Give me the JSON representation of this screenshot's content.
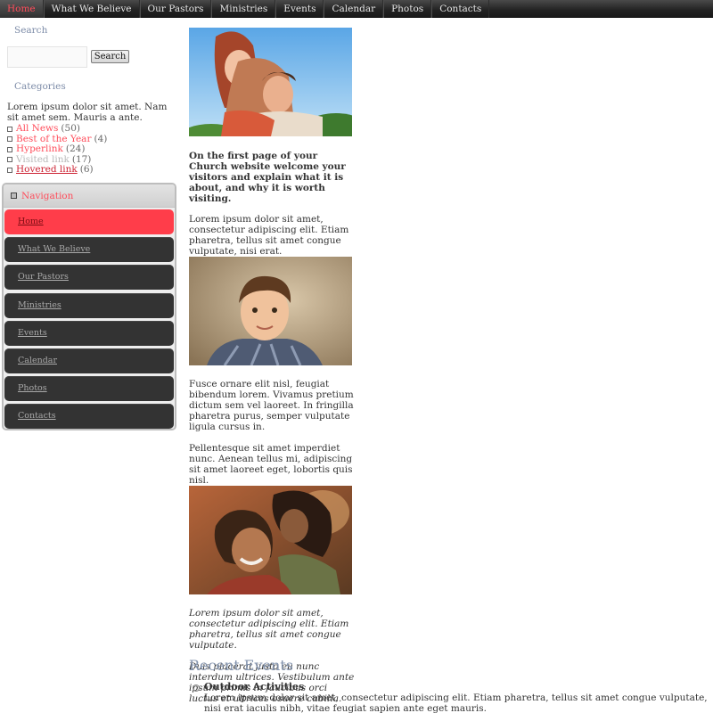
{
  "topnav": {
    "items": [
      "Home",
      "What We Believe",
      "Our Pastors",
      "Ministries",
      "Events",
      "Calendar",
      "Photos",
      "Contacts"
    ],
    "active": "Home"
  },
  "search": {
    "title": "Search",
    "input_value": "",
    "button_label": "Search"
  },
  "categories": {
    "title": "Categories",
    "description": "Lorem ipsum dolor sit amet. Nam sit amet sem. Mauris a ante.",
    "items": [
      {
        "label": "All News",
        "count": "(50)"
      },
      {
        "label": "Best of the Year",
        "count": "(4)"
      },
      {
        "label": "Hyperlink",
        "count": "(24)"
      },
      {
        "label": "Visited link",
        "count": "(17)"
      },
      {
        "label": "Hovered link",
        "count": "(6)"
      }
    ]
  },
  "navigation": {
    "title": "Navigation",
    "items": [
      "Home",
      "What We Believe",
      "Our Pastors",
      "Ministries",
      "Events",
      "Calendar",
      "Photos",
      "Contacts"
    ],
    "active": "Home"
  },
  "content": {
    "images": [
      {
        "icon": "couple-photo"
      },
      {
        "icon": "boy-portrait-photo"
      },
      {
        "icon": "mother-daughter-photo"
      }
    ],
    "intro": "On the first page of your Church website welcome your visitors and explain what it is about, and why it is worth visiting.",
    "para1": "Lorem ipsum dolor sit amet, consectetur adipiscing elit. Etiam pharetra, tellus sit amet congue vulputate, nisi erat.",
    "para2": "Fusce ornare elit nisl, feugiat bibendum lorem. Vivamus pretium dictum sem vel laoreet. In fringilla pharetra purus, semper vulputate ligula cursus in.",
    "para3": "Pellentesque sit amet imperdiet nunc. Aenean tellus mi, adipiscing sit amet laoreet eget, lobortis quis nisl.",
    "italic1": "Lorem ipsum dolor sit amet, consectetur adipiscing elit. Etiam pharetra, tellus sit amet congue vulputate.",
    "italic2": "Duis placerat justo eu nunc interdum ultrices. Vestibulum ante ipsum primis in faucibus orci luctus et ultrices osuere cubilia."
  },
  "recent_events": {
    "title": "Recent Events",
    "items": [
      {
        "title": "Outdoor Activities",
        "description": "Lorem ipsum dolor sit amet, consectetur adipiscing elit. Etiam pharetra, tellus sit amet congue vulputate, nisi erat iaculis nibh, vitae feugiat sapien ante eget mauris."
      }
    ]
  },
  "colors": {
    "accent_red": "#ff3d4a",
    "title_blue": "#7d8ca8",
    "nav_dark": "#333333"
  }
}
